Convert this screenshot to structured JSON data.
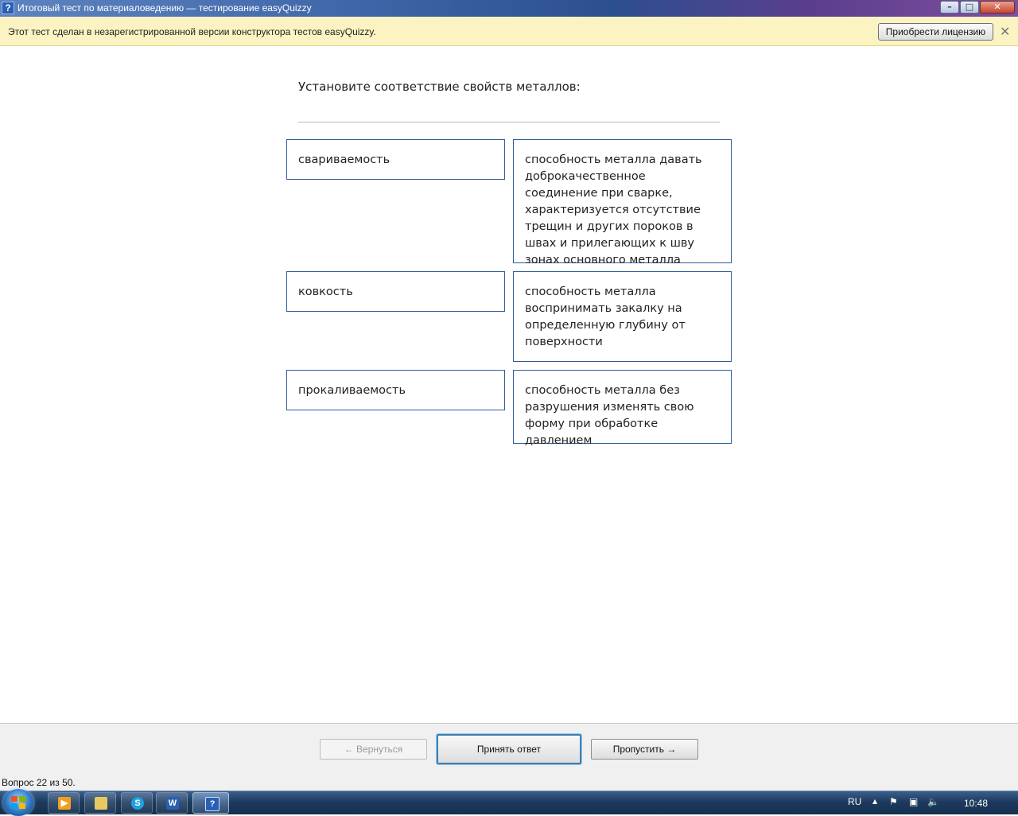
{
  "window": {
    "title": "Итоговый тест по материаловедению — тестирование easyQuizzy",
    "app_icon_glyph": "?",
    "min_glyph": "–",
    "max_glyph": "□",
    "close_glyph": "✕"
  },
  "notice": {
    "text": "Этот тест сделан в незарегистрированной версии конструктора тестов easyQuizzy.",
    "buy_license_label": "Приобрести лицензию",
    "close_glyph": "✕"
  },
  "question": {
    "text": "Установите соответствие свойств металлов:",
    "pairs": [
      {
        "term": "свариваемость",
        "definition": "способность металла давать доброкачественное соединение при сварке, характеризуется отсутствие трещин и других пороков в швах и прилегающих к шву зонах основного металла"
      },
      {
        "term": "ковкость",
        "definition": "способность металла воспринимать закалку на определенную глубину от поверхности"
      },
      {
        "term": "прокаливаемость",
        "definition": "способность металла без разрушения изменять свою форму при обработке давлением"
      }
    ]
  },
  "nav": {
    "back_label": "← Вернуться",
    "accept_label": "Принять ответ",
    "skip_label": "Пропустить →"
  },
  "status": {
    "text": "Вопрос 22 из 50."
  },
  "taskbar": {
    "skype_glyph": "S",
    "word_glyph": "W",
    "quiz_glyph": "?",
    "language": "RU",
    "tray_arrow": "▲",
    "tray_flag": "⚑",
    "tray_network": "▣",
    "tray_volume": "🔈",
    "clock": "10:48"
  },
  "colors": {
    "card_border": "#2f5d9a",
    "notice_bg": "#fbf3c2",
    "accept_focus": "#3c7fb1"
  }
}
